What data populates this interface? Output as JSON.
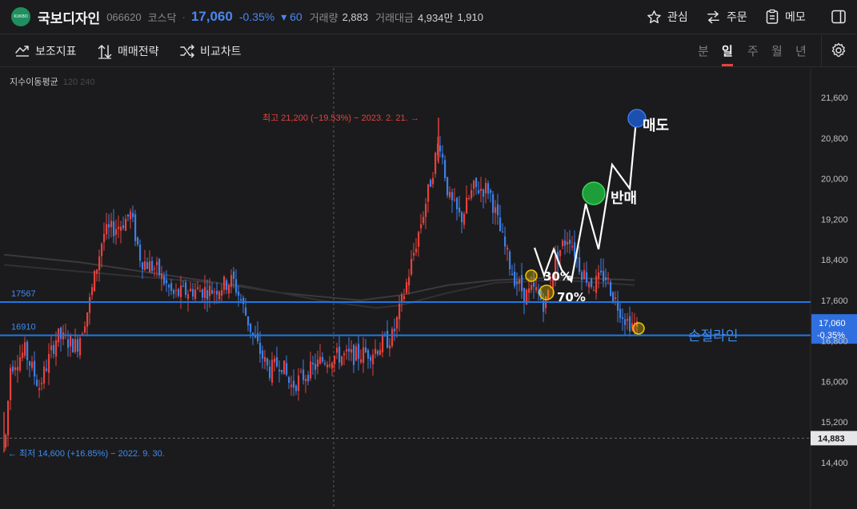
{
  "header": {
    "logo_text": "KUKBO",
    "name": "국보디자인",
    "code": "066620",
    "market": "코스닥",
    "separator": "·",
    "price": "17,060",
    "change_pct": "-0.35%",
    "change_diff": "▾ 60",
    "volume_label": "거래량",
    "volume": "2,883",
    "amount_label": "거래대금",
    "amount": "4,934만",
    "extra_value": "1,910",
    "buttons": {
      "watch": "관심",
      "order": "주문",
      "memo": "메모"
    }
  },
  "toolbar": {
    "indicator": "보조지표",
    "strategy": "매매전략",
    "compare": "비교차트",
    "periods": [
      "분",
      "일",
      "주",
      "월",
      "년"
    ],
    "active_period": "일"
  },
  "chart_data": {
    "type": "candlestick",
    "ma_label": "지수이동평균",
    "ma_periods": "120 240",
    "y_ticks": [
      21600,
      20800,
      20000,
      19200,
      18400,
      17600,
      16800,
      16000,
      15200,
      14400
    ],
    "y_tick_labels": [
      "21,600",
      "20,800",
      "20,000",
      "19,200",
      "18,400",
      "17,600",
      "16,800",
      "16,000",
      "15,200",
      "14,400"
    ],
    "ylim": [
      14000,
      22200
    ],
    "hlines": [
      {
        "label": "17567",
        "value": 17567
      },
      {
        "label": "16910",
        "value": 16910
      }
    ],
    "dashed_level": {
      "label": "14,883",
      "value": 14883
    },
    "current": {
      "price": "17,060",
      "change": "-0.35%",
      "value": 17060
    },
    "high_note": "최고 21,200 (−19.53%) − 2023. 2. 21. →",
    "low_note": "← 최저 14,600 (+16.85%) − 2022. 9. 30.",
    "annotations": {
      "sell": "매도",
      "half_sell": "반매",
      "p30": "30%",
      "p70": "70%",
      "stop": "손절라인"
    },
    "colors": {
      "up": "#e5423c",
      "down": "#3f7fe6",
      "line": "#1e78e6",
      "bg": "#1b1b1d"
    }
  }
}
